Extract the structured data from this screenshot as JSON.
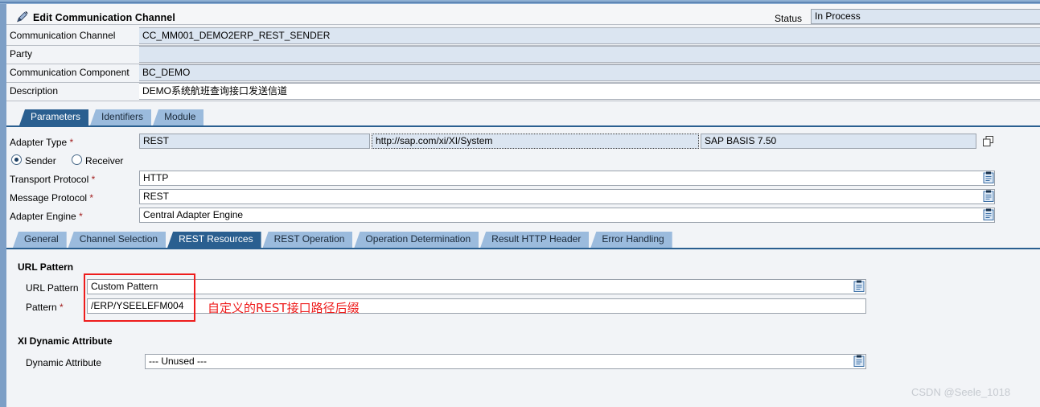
{
  "window": {
    "title": "Edit Communication Channel",
    "title_icon": "pencil-edit-icon",
    "status_label": "Status",
    "status_value": "In Process"
  },
  "header_fields": [
    {
      "label": "Communication Channel",
      "value": "CC_MM001_DEMO2ERP_REST_SENDER",
      "style": "readonly"
    },
    {
      "label": "Party",
      "value": "",
      "style": "readonly"
    },
    {
      "label": "Communication Component",
      "value": "BC_DEMO",
      "style": "readonly"
    },
    {
      "label": "Description",
      "value": "DEMO系统航班查询接口发送信道",
      "style": "editable"
    }
  ],
  "outer_tabs": {
    "selected": "Parameters",
    "items": [
      "Parameters",
      "Identifiers",
      "Module"
    ]
  },
  "adapter": {
    "type_label": "Adapter Type",
    "type_required": "*",
    "type_value": "REST",
    "namespace_value": "http://sap.com/xi/XI/System",
    "swcv_value": "SAP BASIS 7.50",
    "copy_icon": "copy-windows-icon",
    "direction": {
      "sender_label": "Sender",
      "receiver_label": "Receiver",
      "selected": "Sender"
    },
    "rows": [
      {
        "label": "Transport Protocol",
        "required": "*",
        "value": "HTTP",
        "icon": "value-help-icon"
      },
      {
        "label": "Message Protocol",
        "required": "*",
        "value": "REST",
        "icon": "value-help-icon"
      },
      {
        "label": "Adapter Engine",
        "required": "*",
        "value": "Central Adapter Engine",
        "icon": "value-help-icon"
      }
    ]
  },
  "inner_tabs": {
    "selected": "REST Resources",
    "items": [
      "General",
      "Channel Selection",
      "REST Resources",
      "REST Operation",
      "Operation Determination",
      "Result HTTP Header",
      "Error Handling"
    ]
  },
  "url_pattern_section": {
    "title": "URL Pattern",
    "url_pattern_label": "URL Pattern",
    "url_pattern_value": "Custom Pattern",
    "url_pattern_icon": "value-help-icon",
    "pattern_label": "Pattern",
    "pattern_required": "*",
    "pattern_value": "/ERP/YSEELEFM004"
  },
  "xi_dynamic_section": {
    "title": "XI Dynamic Attribute",
    "attribute_label": "Dynamic Attribute",
    "attribute_value": "--- Unused ---",
    "attribute_icon": "value-help-icon"
  },
  "annotation": {
    "text": "自定义的REST接口路径后缀",
    "color": "#ee1c1c",
    "highlight_box_color": "#ee1c1c"
  },
  "watermark": {
    "text": "CSDN @Seele_1018"
  }
}
